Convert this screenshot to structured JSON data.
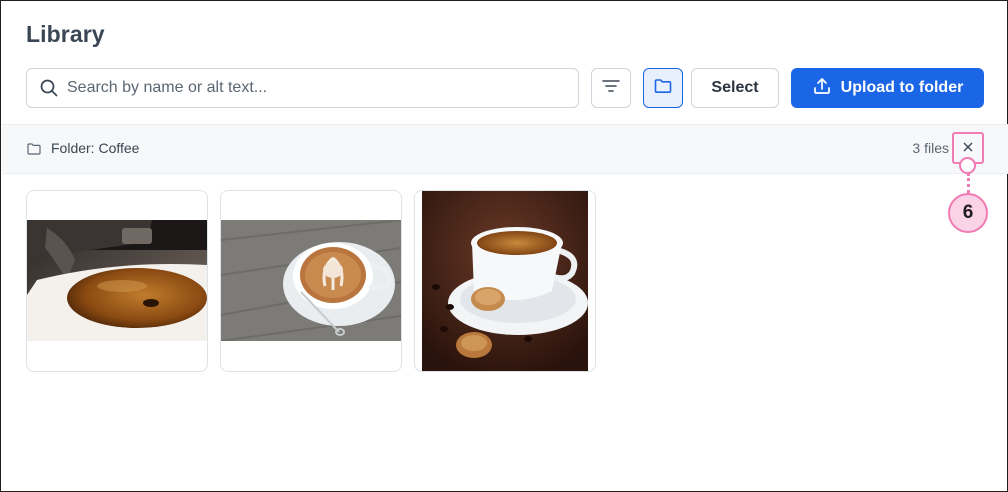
{
  "page": {
    "title": "Library"
  },
  "toolbar": {
    "search_placeholder": "Search by name or alt text...",
    "search_icon": "search-icon",
    "filter_icon": "filter-icon",
    "folder_icon": "folder-icon",
    "select_label": "Select",
    "upload_label": "Upload to folder",
    "upload_icon": "upload-icon",
    "accent_color": "#1a66e6"
  },
  "folder_bar": {
    "label": "Folder: Coffee",
    "count": "3 files",
    "close_icon": "close-icon"
  },
  "annotation": {
    "badge": "6",
    "color": "#f27ab5"
  },
  "images": [
    {
      "subject": "espresso-machine-pouring-cup"
    },
    {
      "subject": "latte-art-cup"
    },
    {
      "subject": "espresso-cup-with-cookies"
    }
  ]
}
